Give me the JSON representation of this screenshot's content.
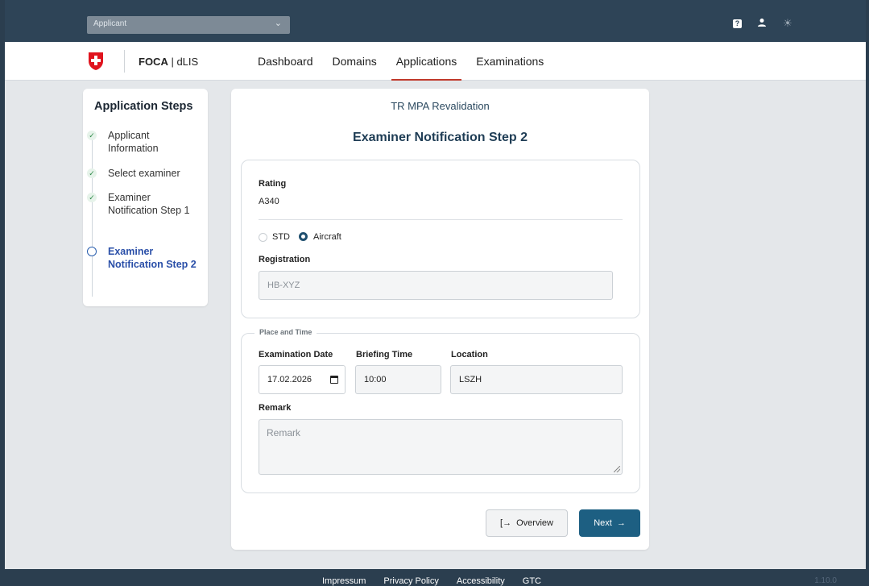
{
  "topbar": {
    "role_select": "Applicant",
    "icons": [
      "help-icon",
      "user-icon",
      "theme-sun-icon"
    ]
  },
  "nav": {
    "brand_bold": "FOCA",
    "brand_rest": " | dLIS",
    "links": [
      "Dashboard",
      "Domains",
      "Applications",
      "Examinations"
    ],
    "active": "Applications"
  },
  "steps": {
    "title": "Application Steps",
    "items": [
      {
        "label": "Applicant Information",
        "state": "done"
      },
      {
        "label": "Select examiner",
        "state": "done"
      },
      {
        "label": "Examiner Notification Step 1",
        "state": "done"
      },
      {
        "label": "Examiner Notification Step 2",
        "state": "active"
      }
    ]
  },
  "form": {
    "subtitle": "TR MPA Revalidation",
    "title": "Examiner Notification Step 2",
    "rating_label": "Rating",
    "rating_value": "A340",
    "radio_std": "STD",
    "radio_aircraft": "Aircraft",
    "selected": "Aircraft",
    "registration_label": "Registration",
    "registration_value": "HB-XYZ",
    "place_time_legend": "Place and Time",
    "exam_date_label": "Examination Date",
    "exam_date_value": "17.02.2026",
    "briefing_label": "Briefing Time",
    "briefing_value": "10:00",
    "location_label": "Location",
    "location_value": "LSZH",
    "remark_label": "Remark",
    "remark_placeholder": "Remark",
    "overview_button": "Overview",
    "next_button": "Next"
  },
  "footer": {
    "links": [
      "Impressum",
      "Privacy Policy",
      "Accessibility",
      "GTC"
    ],
    "version": "1.10.0"
  },
  "colors": {
    "topbar": "#2e4457",
    "primary": "#1d5f82",
    "active_nav_underline": "#c0392b",
    "step_active": "#2a4fa8",
    "step_done": "#2f8a48"
  }
}
